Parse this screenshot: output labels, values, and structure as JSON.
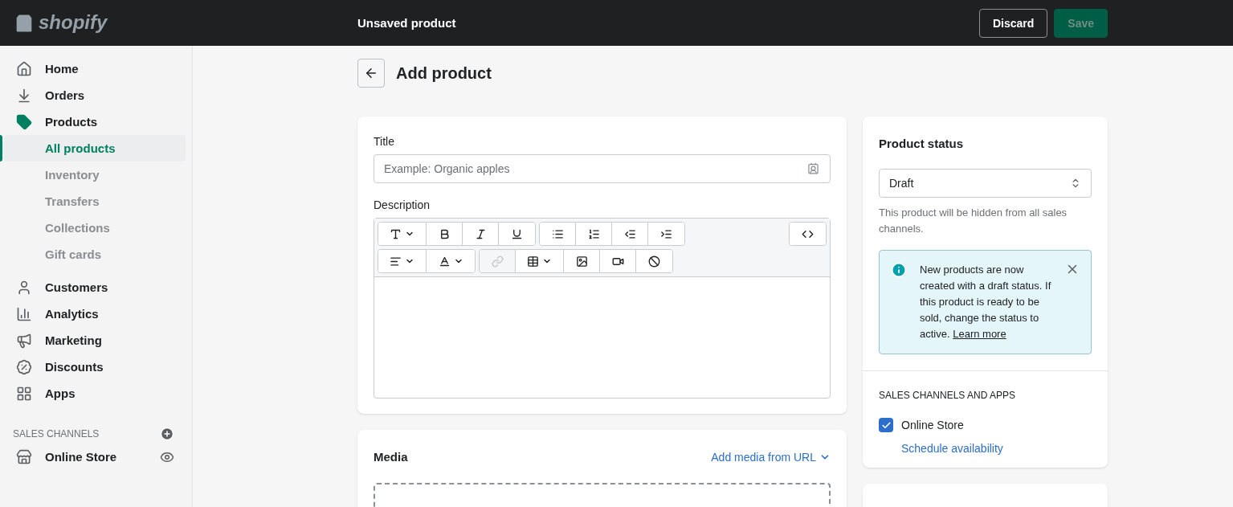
{
  "topbar": {
    "logo": "shopify",
    "title": "Unsaved product",
    "buttons": [
      {
        "label": "Discard",
        "kind": "secondary",
        "disabled": false
      },
      {
        "label": "Save",
        "kind": "primary",
        "disabled": true
      }
    ]
  },
  "sidebar": {
    "items": [
      {
        "label": "Home",
        "selected": false
      },
      {
        "label": "Orders",
        "selected": false
      },
      {
        "label": "Products",
        "selected": true,
        "children": [
          {
            "label": "All products",
            "selected": true
          },
          {
            "label": "Inventory",
            "selected": false
          },
          {
            "label": "Transfers",
            "selected": false
          },
          {
            "label": "Collections",
            "selected": false
          },
          {
            "label": "Gift cards",
            "selected": false
          }
        ]
      },
      {
        "label": "Customers",
        "selected": false
      },
      {
        "label": "Analytics",
        "selected": false
      },
      {
        "label": "Marketing",
        "selected": false
      },
      {
        "label": "Discounts",
        "selected": false
      },
      {
        "label": "Apps",
        "selected": false
      }
    ],
    "section": {
      "heading": "SALES CHANNELS",
      "items": [
        {
          "label": "Online Store"
        }
      ]
    }
  },
  "page": {
    "title": "Add product"
  },
  "product_card": {
    "title_label": "Title",
    "title_placeholder": "Example: Organic apples",
    "description_label": "Description"
  },
  "media_card": {
    "title": "Media",
    "action": "Add media from URL"
  },
  "status_card": {
    "title": "Product status",
    "status_value": "Draft",
    "help": "This product will be hidden from all sales channels.",
    "notice": {
      "text": "New products are now created with a draft status. If this product is ready to be sold, change the status to active.",
      "link": "Learn more"
    },
    "channels_heading": "SALES CHANNELS AND APPS",
    "channels": [
      {
        "label": "Online Store",
        "checked": true
      }
    ],
    "schedule_link": "Schedule availability"
  }
}
